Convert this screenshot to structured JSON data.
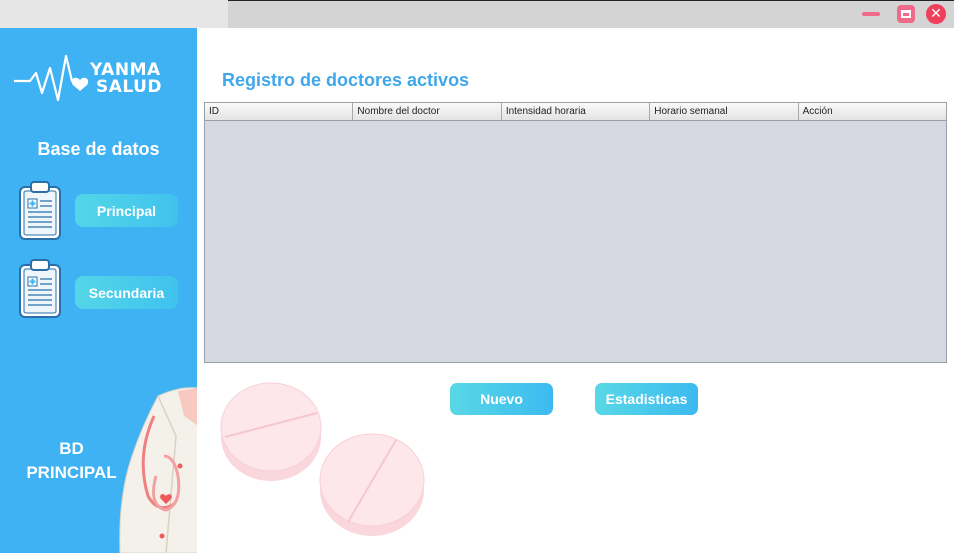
{
  "window": {
    "controls": {
      "close_glyph": "✕"
    }
  },
  "sidebar": {
    "logo": {
      "line1": "YANMA",
      "line2": "SALUD"
    },
    "section_title": "Base de datos",
    "nav": [
      {
        "label": "Principal"
      },
      {
        "label": "Secundaria"
      }
    ],
    "db_label_line1": "BD",
    "db_label_line2": "PRINCIPAL"
  },
  "main": {
    "title": "Registro de doctores activos",
    "table": {
      "columns": [
        "ID",
        "Nombre del doctor",
        "Intensidad horaria",
        "Horario semanal",
        "Acción"
      ],
      "rows": []
    },
    "buttons": {
      "new_label": "Nuevo",
      "stats_label": "Estadisticas"
    }
  },
  "colors": {
    "sidebar": "#3fb2f4",
    "accent_text": "#3fa7ea",
    "button_gradient_start": "#58d8e6",
    "button_gradient_end": "#3cbaf0",
    "window_control": "#f06a8a",
    "close_control": "#ef3f5a"
  }
}
